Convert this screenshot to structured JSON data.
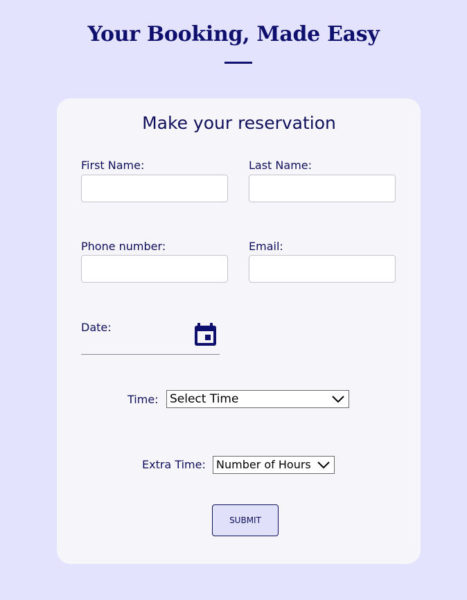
{
  "header": {
    "title": "Your Booking, Made Easy"
  },
  "form": {
    "heading": "Make your reservation",
    "first_name": {
      "label": "First Name:",
      "value": ""
    },
    "last_name": {
      "label": "Last Name:",
      "value": ""
    },
    "phone": {
      "label": "Phone number:",
      "value": ""
    },
    "email": {
      "label": "Email:",
      "value": ""
    },
    "date": {
      "label": "Date:",
      "icon": "calendar-icon"
    },
    "time": {
      "label": "Time:",
      "selected": "Select Time",
      "icon": "chevron-down-icon"
    },
    "extra_time": {
      "label": "Extra Time:",
      "selected": "Number of Hours",
      "icon": "chevron-down-icon"
    },
    "submit_label": "SUBMIT"
  },
  "colors": {
    "page_background": "#e3e3fd",
    "card_background": "#f6f6fa",
    "accent_navy": "#0f0f5c",
    "button_background": "#e0e0fa"
  }
}
